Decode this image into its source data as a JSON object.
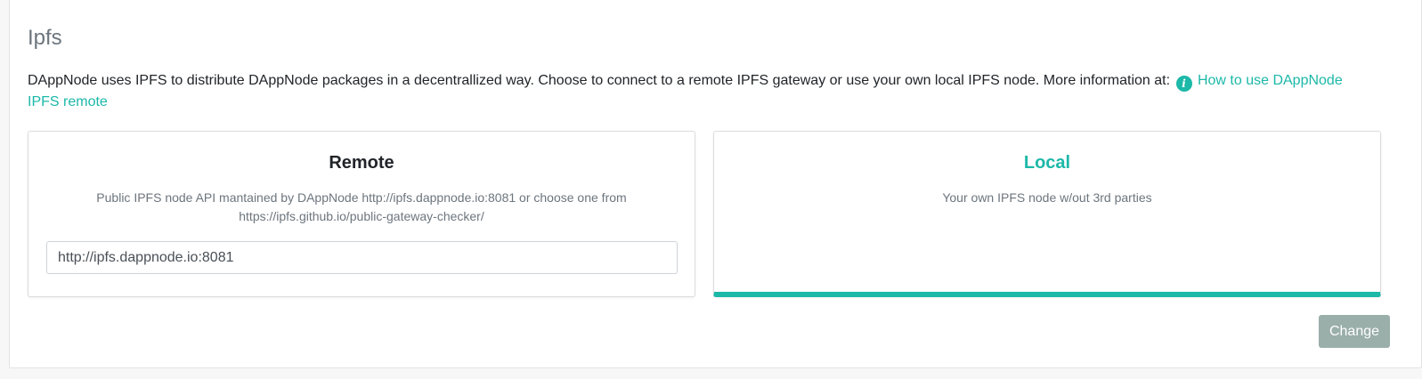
{
  "section": {
    "title": "Ipfs",
    "description": "DAppNode uses IPFS to distribute DAppNode packages in a decentrallized way. Choose to connect to a remote IPFS gateway or use your own local IPFS node. More information at: ",
    "info_link": "How to use DAppNode IPFS remote"
  },
  "options": {
    "remote": {
      "title": "Remote",
      "description": "Public IPFS node API mantained by DAppNode http://ipfs.dappnode.io:8081 or choose one from https://ipfs.github.io/public-gateway-checker/",
      "input_value": "http://ipfs.dappnode.io:8081"
    },
    "local": {
      "title": "Local",
      "description": "Your own IPFS node w/out 3rd parties",
      "selected": true
    }
  },
  "actions": {
    "change_label": "Change"
  },
  "colors": {
    "accent": "#1cb8a8",
    "button_disabled": "#9aaeaa"
  },
  "icons": {
    "info": "info-circle-icon"
  }
}
